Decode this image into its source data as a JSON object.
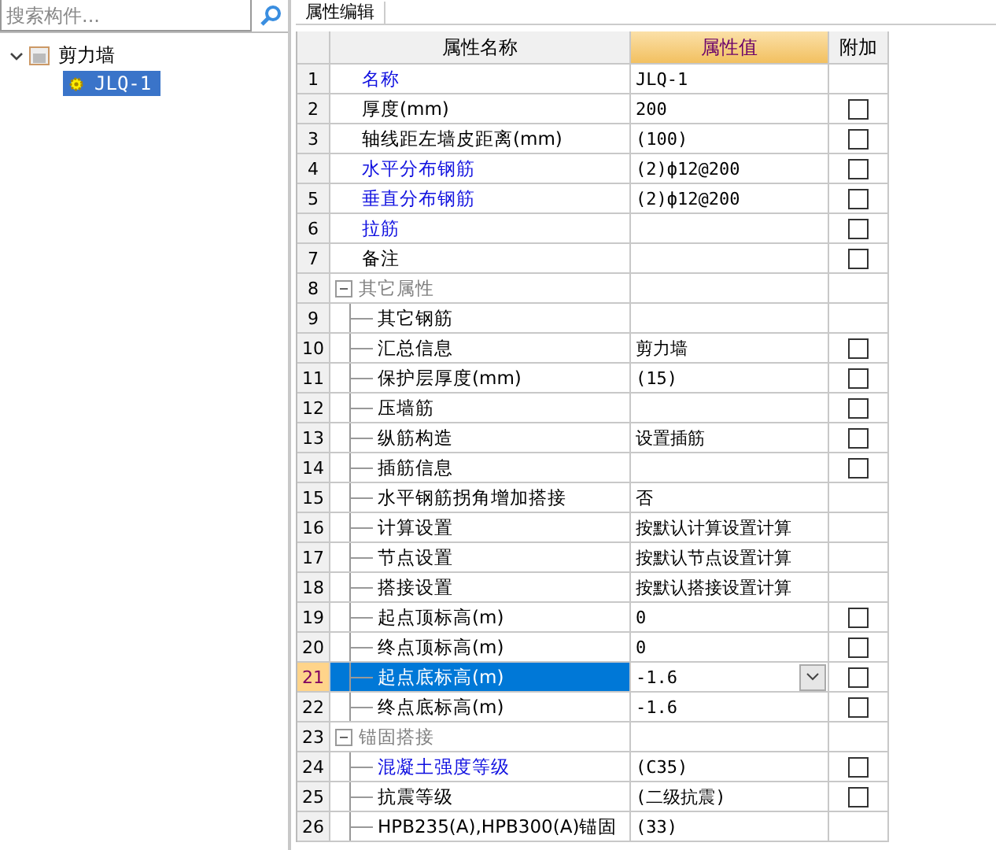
{
  "search": {
    "placeholder": "搜索构件..."
  },
  "tree": [
    {
      "label": "剪力墙",
      "expanded": true,
      "selected": false,
      "children": [
        {
          "label": "JLQ-1",
          "selected": true
        }
      ]
    }
  ],
  "tab": {
    "label": "属性编辑",
    "selected": true
  },
  "table": {
    "columns": [
      {
        "label": "属性名称",
        "selected": false
      },
      {
        "label": "属性值",
        "selected": true
      },
      {
        "label": "附加",
        "selected": false
      }
    ],
    "rows": [
      {
        "num": "1",
        "kind": "prop",
        "name": "名称",
        "link": true,
        "value": "JLQ-1",
        "selected": false
      },
      {
        "num": "2",
        "kind": "prop",
        "name": "厚度(mm)",
        "link": false,
        "value": "200",
        "selected": false,
        "checked": false
      },
      {
        "num": "3",
        "kind": "prop",
        "name": "轴线距左墙皮距离(mm)",
        "link": false,
        "value": "(100)",
        "selected": false,
        "checked": false
      },
      {
        "num": "4",
        "kind": "prop",
        "name": "水平分布钢筋",
        "link": true,
        "value": "(2)ф12@200",
        "selected": false,
        "checked": false
      },
      {
        "num": "5",
        "kind": "prop",
        "name": "垂直分布钢筋",
        "link": true,
        "value": "(2)ф12@200",
        "selected": false,
        "checked": false
      },
      {
        "num": "6",
        "kind": "prop",
        "name": "拉筋",
        "link": true,
        "value": "",
        "selected": false,
        "checked": false
      },
      {
        "num": "7",
        "kind": "prop",
        "name": "备注",
        "link": false,
        "value": "",
        "selected": false,
        "checked": false
      },
      {
        "num": "8",
        "kind": "group",
        "name": "其它属性",
        "expanded": true,
        "selected": false
      },
      {
        "num": "9",
        "kind": "child",
        "name": "其它钢筋",
        "link": false,
        "value": "",
        "selected": false
      },
      {
        "num": "10",
        "kind": "child",
        "name": "汇总信息",
        "link": false,
        "value": "剪力墙",
        "selected": false,
        "checked": false
      },
      {
        "num": "11",
        "kind": "child",
        "name": "保护层厚度(mm)",
        "link": false,
        "value": "(15)",
        "selected": false,
        "checked": false
      },
      {
        "num": "12",
        "kind": "child",
        "name": "压墙筋",
        "link": false,
        "value": "",
        "selected": false,
        "checked": false
      },
      {
        "num": "13",
        "kind": "child",
        "name": "纵筋构造",
        "link": false,
        "value": "设置插筋",
        "selected": false,
        "checked": false
      },
      {
        "num": "14",
        "kind": "child",
        "name": "插筋信息",
        "link": false,
        "value": "",
        "selected": false,
        "checked": false
      },
      {
        "num": "15",
        "kind": "child",
        "name": "水平钢筋拐角增加搭接",
        "link": false,
        "value": "否",
        "selected": false
      },
      {
        "num": "16",
        "kind": "child",
        "name": "计算设置",
        "link": false,
        "value": "按默认计算设置计算",
        "selected": false
      },
      {
        "num": "17",
        "kind": "child",
        "name": "节点设置",
        "link": false,
        "value": "按默认节点设置计算",
        "selected": false
      },
      {
        "num": "18",
        "kind": "child",
        "name": "搭接设置",
        "link": false,
        "value": "按默认搭接设置计算",
        "selected": false
      },
      {
        "num": "19",
        "kind": "child",
        "name": "起点顶标高(m)",
        "link": false,
        "value": "0",
        "selected": false,
        "checked": false
      },
      {
        "num": "20",
        "kind": "child",
        "name": "终点顶标高(m)",
        "link": false,
        "value": "0",
        "selected": false,
        "checked": false
      },
      {
        "num": "21",
        "kind": "child",
        "name": "起点底标高(m)",
        "link": false,
        "value": "-1.6",
        "selected": true,
        "checked": false
      },
      {
        "num": "22",
        "kind": "child",
        "name": "终点底标高(m)",
        "link": false,
        "value": "-1.6",
        "selected": false,
        "checked": false
      },
      {
        "num": "23",
        "kind": "group",
        "name": "锚固搭接",
        "expanded": true,
        "selected": false
      },
      {
        "num": "24",
        "kind": "child",
        "name": "混凝土强度等级",
        "link": true,
        "value": "(C35)",
        "selected": false,
        "checked": false
      },
      {
        "num": "25",
        "kind": "child",
        "name": "抗震等级",
        "link": false,
        "value": "(二级抗震)",
        "selected": false,
        "checked": false
      },
      {
        "num": "26",
        "kind": "child",
        "name": "HPB235(A),HPB300(A)锚固",
        "link": false,
        "value": "(33)",
        "selected": false
      }
    ]
  }
}
